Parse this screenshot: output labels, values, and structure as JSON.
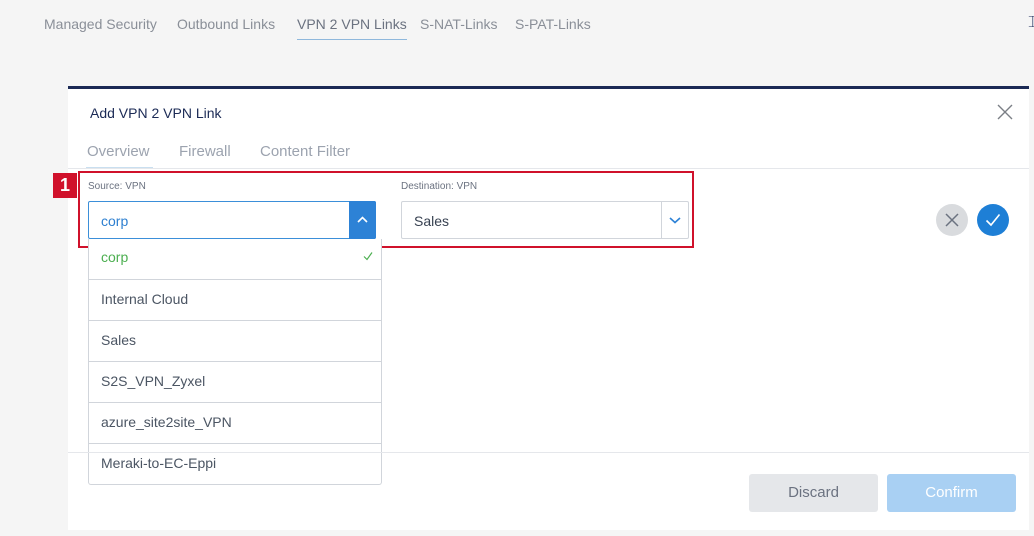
{
  "top_tabs": [
    {
      "label": "Managed Security",
      "active": false
    },
    {
      "label": "Outbound Links",
      "active": false
    },
    {
      "label": "VPN 2 VPN Links",
      "active": true
    },
    {
      "label": "S-NAT-Links",
      "active": false
    },
    {
      "label": "S-PAT-Links",
      "active": false
    }
  ],
  "modal": {
    "title": "Add VPN 2 VPN Link",
    "tabs": [
      {
        "label": "Overview",
        "active": true
      },
      {
        "label": "Firewall",
        "active": false
      },
      {
        "label": "Content Filter",
        "active": false
      }
    ],
    "annotation_number": "1",
    "source": {
      "label": "Source: VPN",
      "value": "corp",
      "options": [
        "corp",
        "Internal Cloud",
        "Sales",
        "S2S_VPN_Zyxel",
        "azure_site2site_VPN",
        "Meraki-to-EC-Eppi"
      ],
      "selected_index": 0
    },
    "destination": {
      "label": "Destination: VPN",
      "value": "Sales"
    },
    "footer": {
      "discard_label": "Discard",
      "confirm_label": "Confirm"
    }
  },
  "colors": {
    "accent": "#2d82d6",
    "annotation_red": "#d0112b",
    "modal_border": "#1b2a55",
    "selected_option": "#4caf50"
  }
}
